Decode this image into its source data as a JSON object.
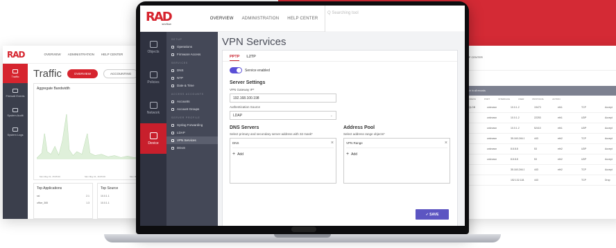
{
  "left_window": {
    "logo": "RAD",
    "nav": [
      "OVERVIEW",
      "ADMINISTRATION",
      "HELP CENTER"
    ],
    "sidebar": [
      {
        "label": "Traffic",
        "active": true
      },
      {
        "label": "Firewall Events",
        "active": false
      },
      {
        "label": "System Audit",
        "active": false
      },
      {
        "label": "System Logs",
        "active": false
      }
    ],
    "title": "Traffic",
    "tabs": [
      {
        "label": "OVERVIEW",
        "active": true
      },
      {
        "label": "ACCOUNTING",
        "active": false
      }
    ],
    "chart_title": "Aggregate Bandwidth",
    "x_labels": [
      "Mon May 21, 15:05:00",
      "Mon May 21, 16:05:00",
      "Mon May 21, 16:15:13"
    ],
    "top_apps_title": "Top Applications",
    "top_apps": [
      {
        "name": "ssl",
        "value": "2.1"
      },
      {
        "name": "office_365",
        "value": "1.3"
      }
    ],
    "top_sources_title": "Top Source",
    "top_sources": [
      "10.0.1.1",
      "10.0.1.1"
    ]
  },
  "right_window": {
    "nav": "HELP CENTER",
    "band_text": "Search in all records",
    "group_header": "DESTINATION",
    "columns": [
      "IP ADDRESS",
      "PORT",
      "INTERFACE",
      "USER",
      "PROTOCOL",
      "ACTION"
    ],
    "rows": [
      [
        "MSSQLDB",
        "unknown",
        "10.0.1.2",
        "19473",
        "eth1",
        "TCP",
        "Accept"
      ],
      [
        "dns",
        "unknown",
        "10.0.1.2",
        "22253",
        "eth1",
        "UDP",
        "Accept"
      ],
      [
        "ntp",
        "unknown",
        "10.0.1.2",
        "52410",
        "eth1",
        "UDP",
        "Accept"
      ],
      [
        "https",
        "unknown",
        "35.160.246.107",
        "443",
        "eth2",
        "TCP",
        "Accept"
      ],
      [
        "dns",
        "unknown",
        "8.8.8.8",
        "53",
        "eth2",
        "UDP",
        "Accept"
      ],
      [
        "dns",
        "unknown",
        "8.8.8.8",
        "53",
        "eth2",
        "UDP",
        "Accept"
      ],
      [
        "https",
        "",
        "35.160.246.107",
        "443",
        "eth2",
        "TCP",
        "Accept"
      ],
      [
        "https",
        "",
        "152.132.118.195",
        "443",
        "",
        "TCP",
        "Drop"
      ]
    ]
  },
  "app": {
    "logo": "RAD",
    "logo_sub": "secflow",
    "nav": [
      {
        "label": "OVERVIEW",
        "active": true
      },
      {
        "label": "ADMINISTRATION",
        "active": false
      },
      {
        "label": "HELP CENTER",
        "active": false
      }
    ],
    "search_placeholder": "Q  Searching tool",
    "sidebar1": [
      {
        "label": "Objects",
        "icon": "objects-icon",
        "active": false
      },
      {
        "label": "Policies",
        "icon": "policies-icon",
        "active": false
      },
      {
        "label": "Network",
        "icon": "network-icon",
        "active": false
      },
      {
        "label": "Device",
        "icon": "device-icon",
        "active": true
      }
    ],
    "sidebar2": {
      "setup_title": "SETUP",
      "setup": [
        "Operations",
        "Firmware Access"
      ],
      "services_title": "SERVICES",
      "services": [
        "DNS",
        "NTP",
        "Date & Time"
      ],
      "access_title": "ACCESS ACCOUNTS",
      "access": [
        "Accounts",
        "Account Groups"
      ],
      "profile_title": "SERVER PROFILE",
      "profile": [
        "Syslog Forwarding",
        "LDAP",
        "VPN Services",
        "DDoS"
      ],
      "active": "VPN Services"
    },
    "page_title": "VPN Services",
    "tabs": [
      {
        "label": "PPTP",
        "active": true
      },
      {
        "label": "L2TP",
        "active": false
      }
    ],
    "service_toggle_label": "Service enabled",
    "server_settings_title": "Server Settings",
    "gateway_label": "VPN Gateway IP*",
    "gateway_value": "192.168.100.198",
    "auth_label": "Authentication Source",
    "auth_value": "LDAP",
    "dns_title": "DNS Servers",
    "dns_hint": "Select primary and secondary server address with 32 mask*",
    "dns_chip": "DNS",
    "pool_title": "Address Pool",
    "pool_hint": "Select address range objects*",
    "pool_chip": "VPN Range",
    "add_label": "Add",
    "save_label": "✓ SAVE"
  }
}
